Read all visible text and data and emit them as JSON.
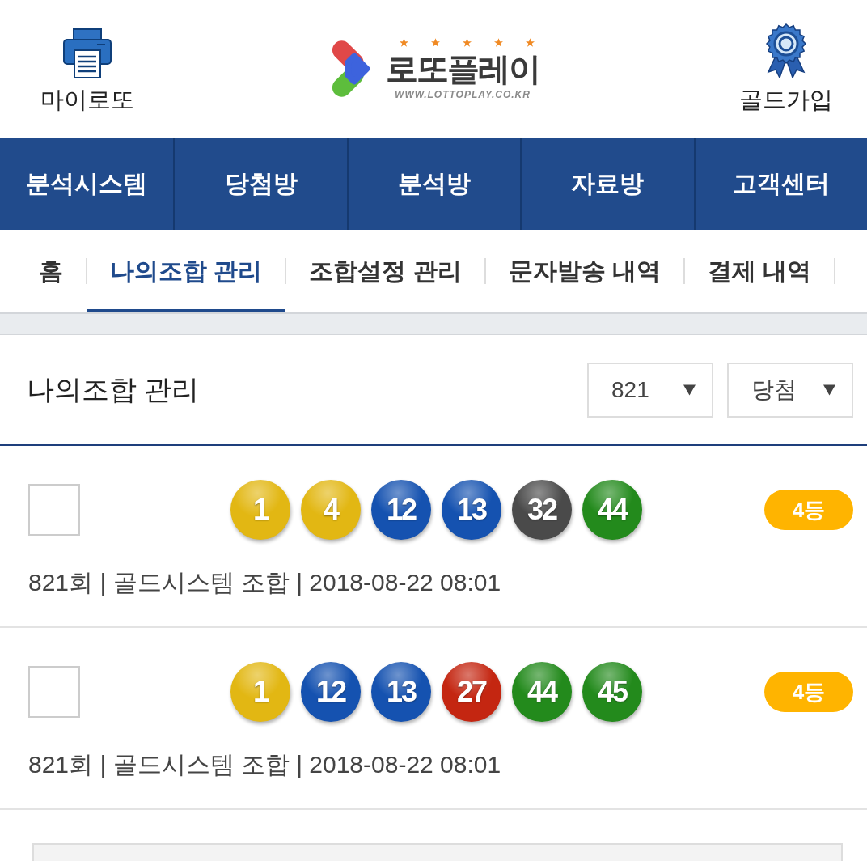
{
  "header": {
    "left_link": {
      "label": "마이로또"
    },
    "logo": {
      "name": "로또플레이",
      "url": "WWW.LOTTOPLAY.CO.KR"
    },
    "right_link": {
      "label": "골드가입"
    }
  },
  "main_nav": [
    {
      "label": "분석시스템"
    },
    {
      "label": "당첨방"
    },
    {
      "label": "분석방"
    },
    {
      "label": "자료방"
    },
    {
      "label": "고객센터"
    }
  ],
  "sub_tabs": [
    {
      "label": "홈",
      "selected": false
    },
    {
      "label": "나의조합 관리",
      "selected": true
    },
    {
      "label": "조합설정 관리",
      "selected": false
    },
    {
      "label": "문자발송 내역",
      "selected": false
    },
    {
      "label": "결제 내역",
      "selected": false
    }
  ],
  "section": {
    "title": "나의조합 관리",
    "filters": [
      {
        "value": "821"
      },
      {
        "value": "당첨"
      }
    ]
  },
  "combinations": [
    {
      "checked": false,
      "balls": [
        {
          "number": "1",
          "color": "#e2b713"
        },
        {
          "number": "4",
          "color": "#e2b713"
        },
        {
          "number": "12",
          "color": "#1552b0"
        },
        {
          "number": "13",
          "color": "#1552b0"
        },
        {
          "number": "32",
          "color": "#4a4a4a"
        },
        {
          "number": "44",
          "color": "#238a1c"
        }
      ],
      "rank": "4등",
      "meta": "821회 | 골드시스템 조합 | 2018-08-22 08:01"
    },
    {
      "checked": false,
      "balls": [
        {
          "number": "1",
          "color": "#e2b713"
        },
        {
          "number": "12",
          "color": "#1552b0"
        },
        {
          "number": "13",
          "color": "#1552b0"
        },
        {
          "number": "27",
          "color": "#c42611"
        },
        {
          "number": "44",
          "color": "#238a1c"
        },
        {
          "number": "45",
          "color": "#238a1c"
        }
      ],
      "rank": "4등",
      "meta": "821회 | 골드시스템 조합 | 2018-08-22 08:01"
    }
  ]
}
